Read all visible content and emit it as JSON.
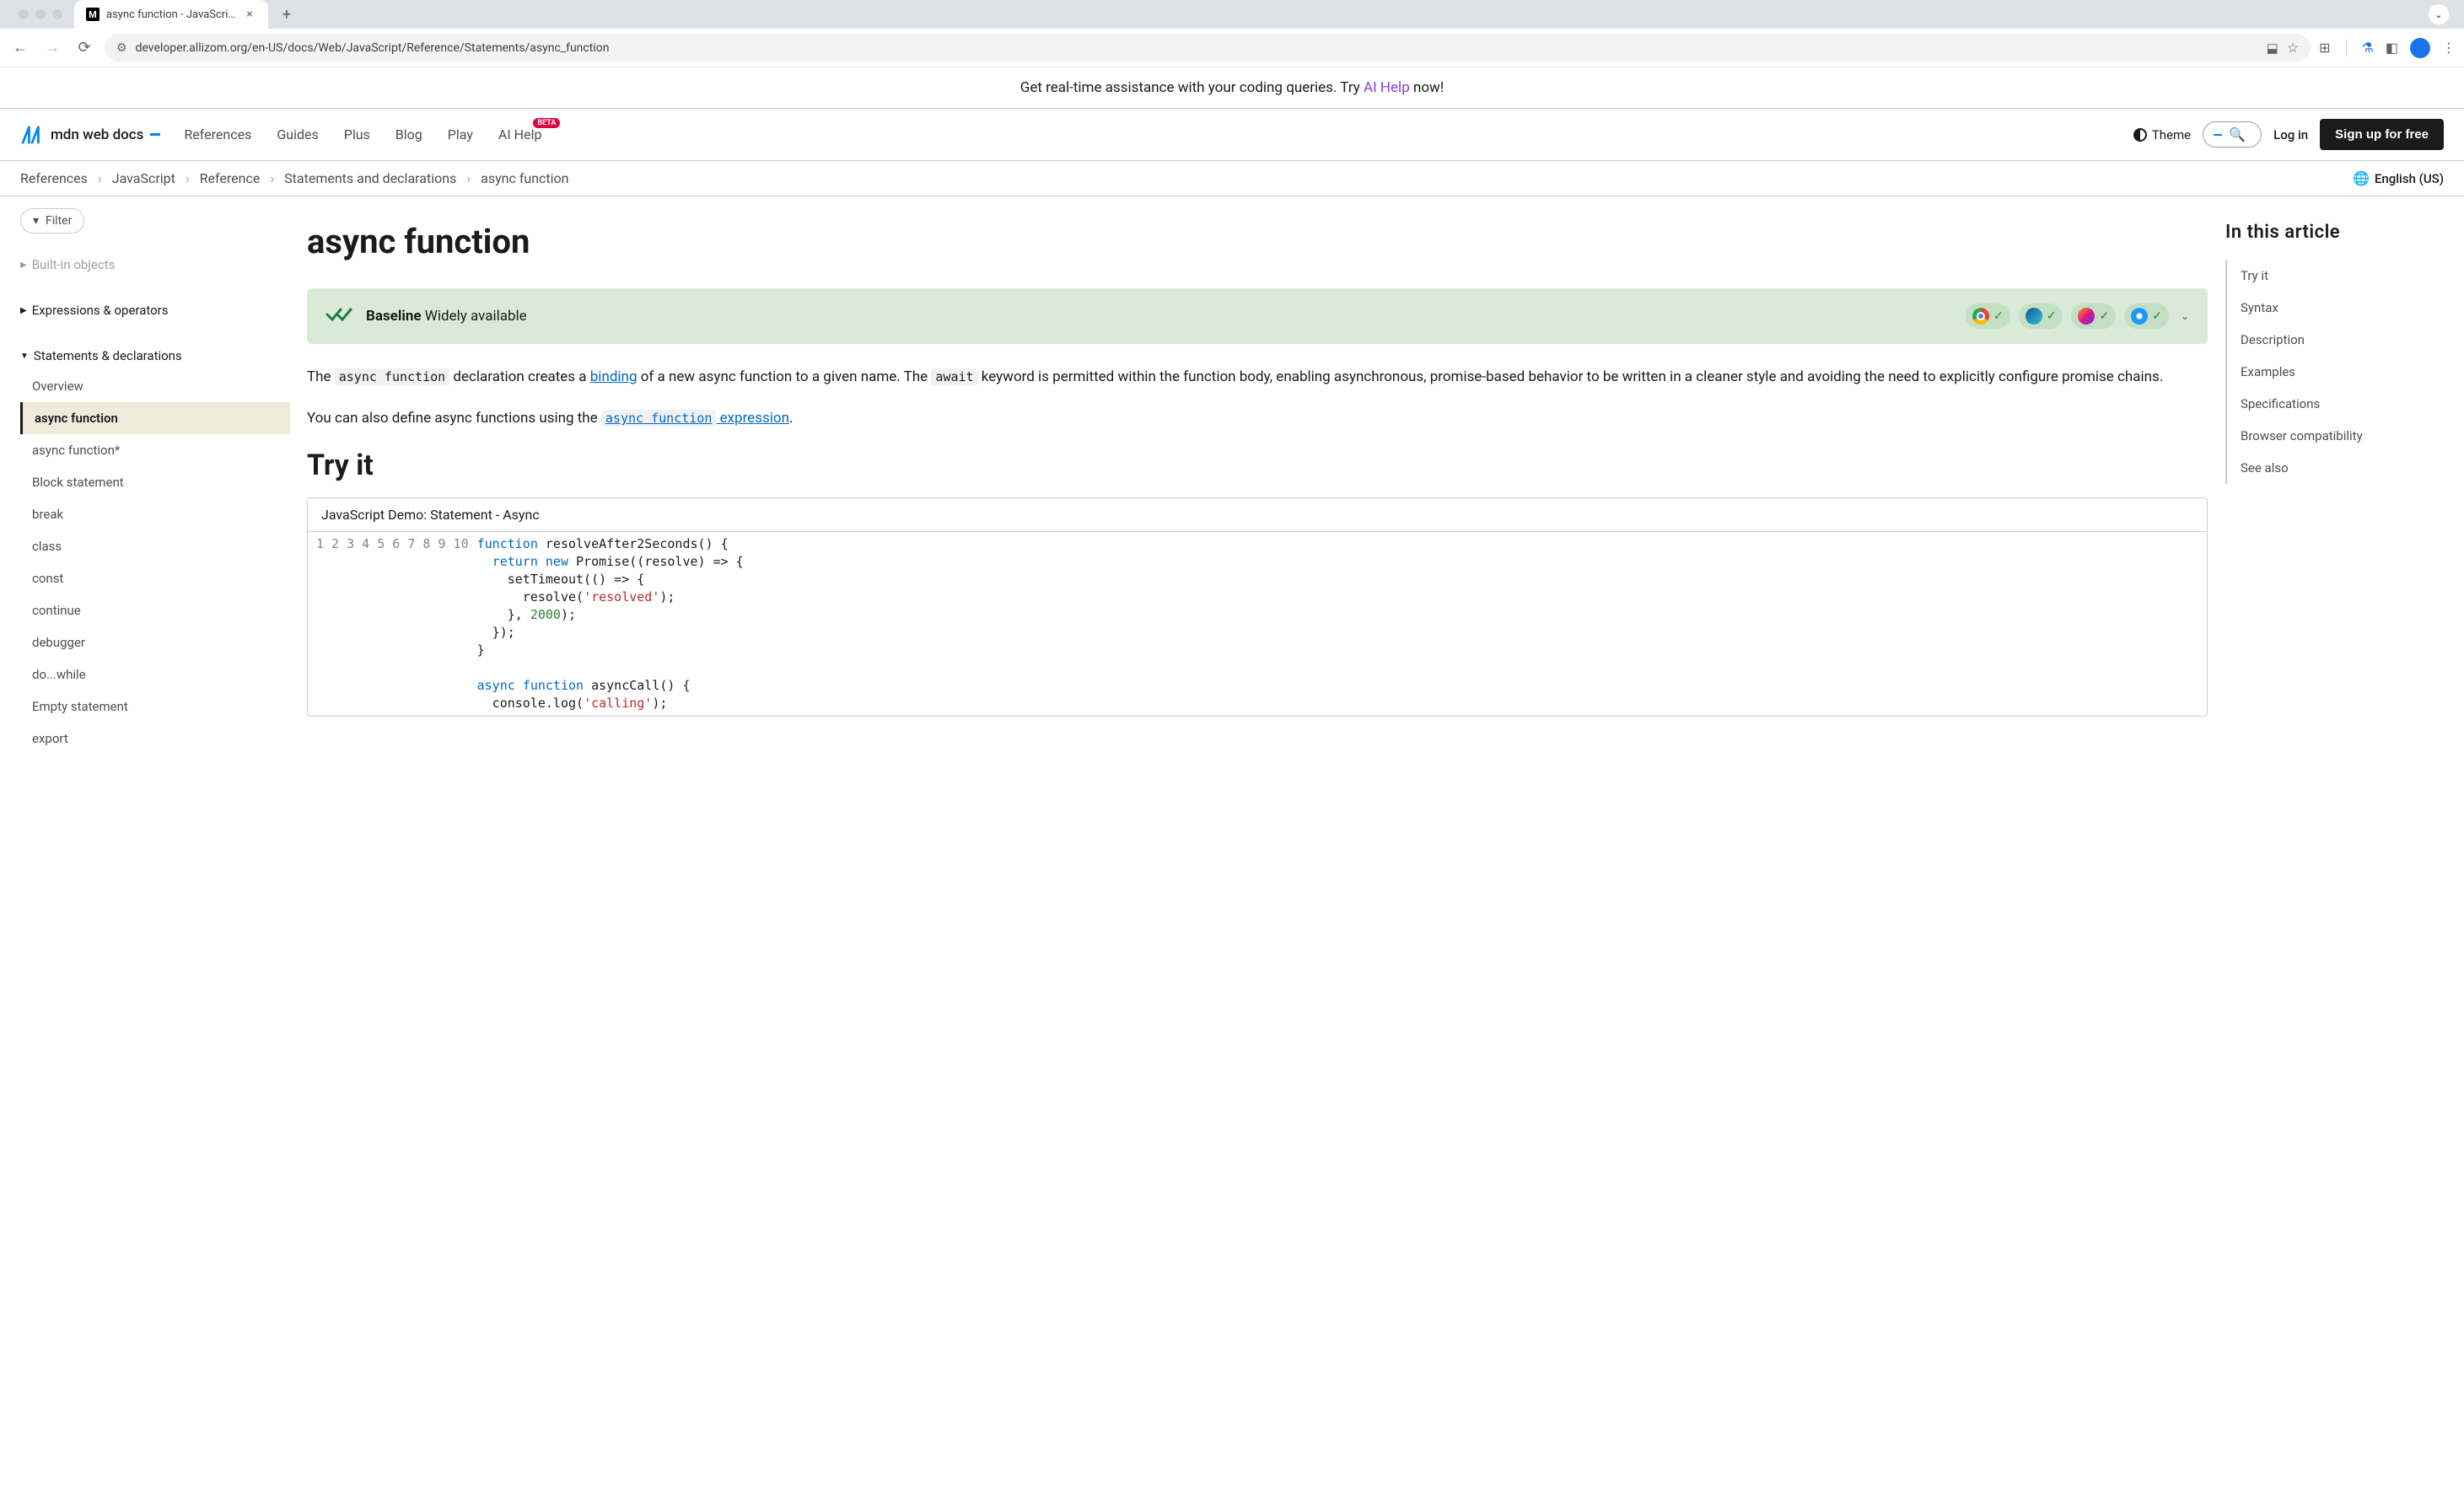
{
  "browser": {
    "tab_title": "async function - JavaScript |",
    "url": "developer.allizom.org/en-US/docs/Web/JavaScript/Reference/Statements/async_function"
  },
  "promo": {
    "text_before": "Get real-time assistance with your coding queries. Try ",
    "link_text": "AI Help",
    "text_after": " now!"
  },
  "header": {
    "logo_text": "mdn web docs",
    "nav": {
      "references": "References",
      "guides": "Guides",
      "plus": "Plus",
      "blog": "Blog",
      "play": "Play",
      "ai_help": "AI Help",
      "beta_badge": "BETA"
    },
    "theme_label": "Theme",
    "login_label": "Log in",
    "signup_label": "Sign up for free"
  },
  "breadcrumb": {
    "items": [
      "References",
      "JavaScript",
      "Reference",
      "Statements and declarations",
      "async function"
    ],
    "lang_label": "English (US)"
  },
  "sidebar": {
    "filter_label": "Filter",
    "built_in_label": "Built-in objects",
    "expressions_label": "Expressions & operators",
    "statements_label": "Statements & declarations",
    "items": [
      "Overview",
      "async function",
      "async function*",
      "Block statement",
      "break",
      "class",
      "const",
      "continue",
      "debugger",
      "do...while",
      "Empty statement",
      "export"
    ],
    "selected_index": 1
  },
  "article": {
    "title": "async function",
    "baseline": {
      "bold": "Baseline",
      "rest": " Widely available"
    },
    "p1": {
      "t1": "The ",
      "c1": "async function",
      "t2": " declaration creates a ",
      "link1": "binding",
      "t3": " of a new async function to a given name. The ",
      "c2": "await",
      "t4": " keyword is permitted within the function body, enabling asynchronous, promise-based behavior to be written in a cleaner style and avoiding the need to explicitly configure promise chains."
    },
    "p2": {
      "t1": "You can also define async functions using the ",
      "linkcode": "async function",
      "linktext": " expression",
      "t2": "."
    },
    "tryit_heading": "Try it",
    "demo_header": "JavaScript Demo: Statement - Async",
    "code_lines": [
      {
        "n": "1",
        "html": "<span class='tok-kw'>function</span> resolveAfter2Seconds() {"
      },
      {
        "n": "2",
        "html": "  <span class='tok-kw'>return</span> <span class='tok-kw'>new</span> Promise((resolve) =&gt; {"
      },
      {
        "n": "3",
        "html": "    setTimeout(() =&gt; {"
      },
      {
        "n": "4",
        "html": "      resolve(<span class='tok-str'>'resolved'</span>);"
      },
      {
        "n": "5",
        "html": "    }, <span class='tok-num'>2000</span>);"
      },
      {
        "n": "6",
        "html": "  });"
      },
      {
        "n": "7",
        "html": "}"
      },
      {
        "n": "8",
        "html": ""
      },
      {
        "n": "9",
        "html": "<span class='tok-kw'>async</span> <span class='tok-kw'>function</span> asyncCall() {"
      },
      {
        "n": "10",
        "html": "  console.log(<span class='tok-str'>'calling'</span>);"
      }
    ]
  },
  "toc": {
    "title": "In this article",
    "items": [
      "Try it",
      "Syntax",
      "Description",
      "Examples",
      "Specifications",
      "Browser compatibility",
      "See also"
    ]
  }
}
